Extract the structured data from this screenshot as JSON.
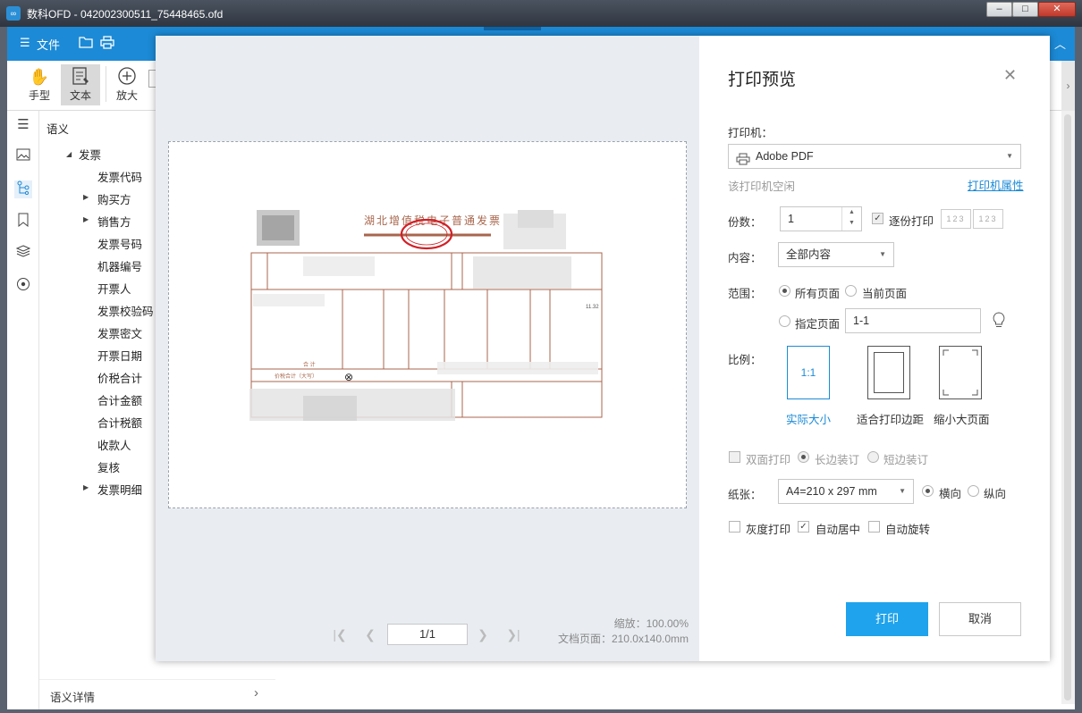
{
  "window": {
    "title": "数科OFD - 042002300511_75448465.ofd",
    "logo": "∞"
  },
  "window_controls": {
    "minimize": "–",
    "maximize": "□",
    "close": "✕"
  },
  "menubar": {
    "file_label": "文件"
  },
  "toolbar": {
    "hand_label": "手型",
    "text_label": "文本",
    "zoom_in_label": "放大"
  },
  "tree": {
    "root_label": "语义",
    "invoice_label": "发票",
    "items": [
      "发票代码",
      "购买方",
      "销售方",
      "发票号码",
      "机器编号",
      "开票人",
      "发票校验码",
      "发票密文",
      "开票日期",
      "价税合计",
      "合计金额",
      "合计税额",
      "收款人",
      "复核",
      "发票明细"
    ],
    "footer_label": "语义详情"
  },
  "dialog": {
    "title": "打印预览",
    "printer_label": "打印机：",
    "printer_value": "Adobe PDF",
    "printer_status": "该打印机空闲",
    "printer_props": "打印机属性",
    "copies_label": "份数：",
    "copies_value": "1",
    "collate_label": "逐份打印",
    "content_label": "内容：",
    "content_value": "全部内容",
    "range_label": "范围：",
    "range_all": "所有页面",
    "range_current": "当前页面",
    "range_custom": "指定页面",
    "range_custom_value": "1-1",
    "scale_label": "比例：",
    "scale_actual_box": "1:1",
    "scale_actual": "实际大小",
    "scale_fit": "适合打印边距",
    "scale_shrink": "缩小大页面",
    "duplex": "双面打印",
    "long_edge": "长边装订",
    "short_edge": "短边装订",
    "paper_label": "纸张：",
    "paper_value": "A4=210 x 297 mm",
    "landscape": "横向",
    "portrait": "纵向",
    "grayscale": "灰度打印",
    "auto_center": "自动居中",
    "auto_rotate": "自动旋转",
    "print_button": "打印",
    "cancel_button": "取消",
    "page_indicator": "1/1",
    "zoom_info": "缩放：100.00%",
    "doc_page_info": "文档页面：210.0x140.0mm"
  },
  "invoice_preview": {
    "title": "湖北增值税电子普通发票",
    "total_row_label": "合 计",
    "tax_total_label": "价税合计（大写）",
    "amount": "11.32",
    "cancel_mark": "⊗"
  },
  "colors": {
    "accent": "#1c8ad6",
    "primary_button": "#1fa3ec",
    "invoice_line": "#a8664c",
    "seal": "#d21f26"
  }
}
